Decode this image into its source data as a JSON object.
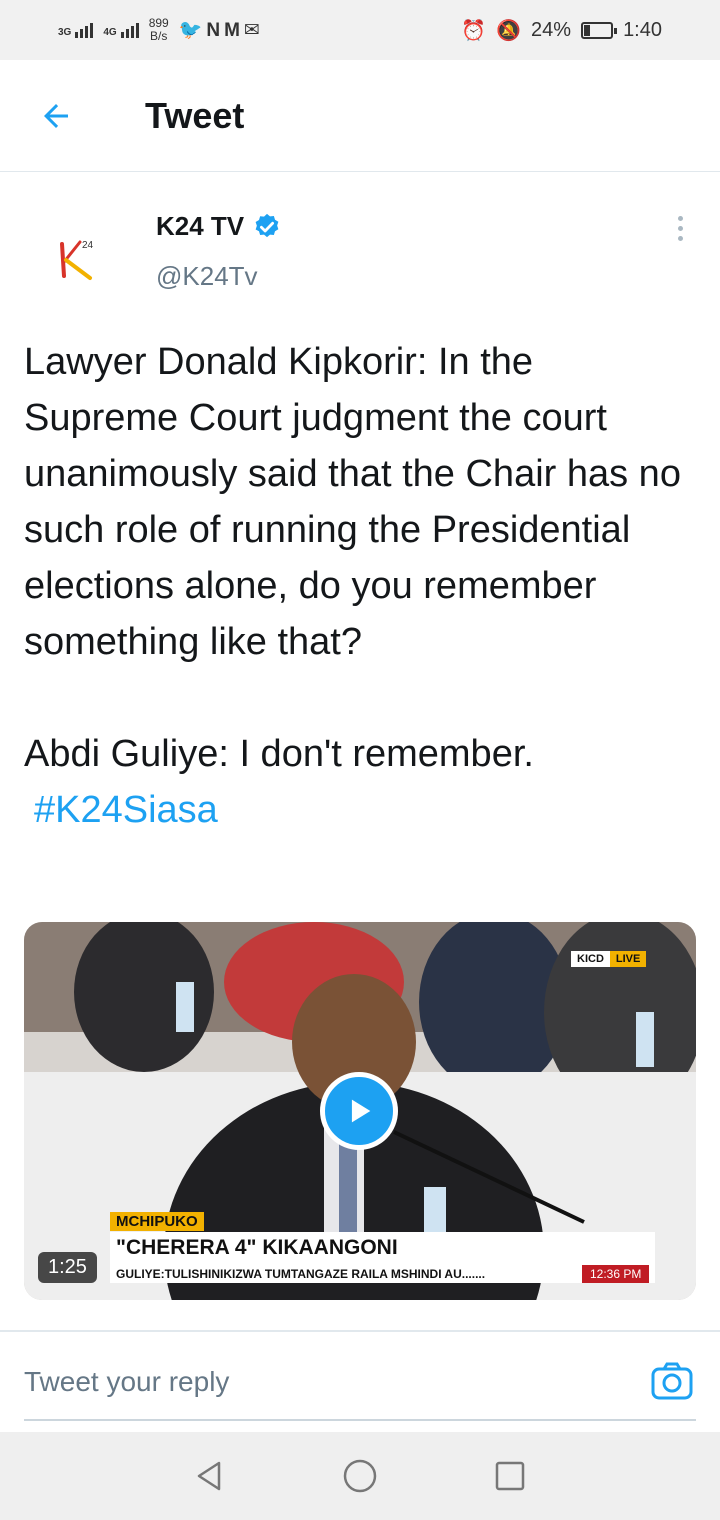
{
  "status_bar": {
    "net1": "3G",
    "net2": "4G",
    "speed_value": "899",
    "speed_unit": "B/s",
    "notif_icons": "twitter-icon n-icon gmail-icon message-icon",
    "battery_pct": "24%",
    "battery_fraction": 0.24,
    "time": "1:40"
  },
  "header": {
    "title": "Tweet"
  },
  "tweet": {
    "author_name": "K24 TV",
    "verified": true,
    "handle": "@K24Tv",
    "text": "Lawyer Donald Kipkorir: In the Supreme Court judgment the court unanimously said that the Chair has no such role of running the Presidential elections alone, do you remember something like that?\n\nAbdi Guliye: I don't remember.",
    "hashtag": "#K24Siasa"
  },
  "video": {
    "badge_left": "KICD",
    "badge_right": "LIVE",
    "lower_third_tag": "MCHIPUKO",
    "headline": "\"CHERERA 4\" KIKAANGONI",
    "ticker": "GULIYE:TULISHINIKIZWA TUMTANGAZE RAILA MSHINDI AU.......",
    "ticker_time": "12:36 PM",
    "duration": "1:25"
  },
  "reply": {
    "placeholder": "Tweet your reply"
  },
  "colors": {
    "accent": "#1da1f2",
    "text": "#14171a",
    "muted": "#657786"
  }
}
